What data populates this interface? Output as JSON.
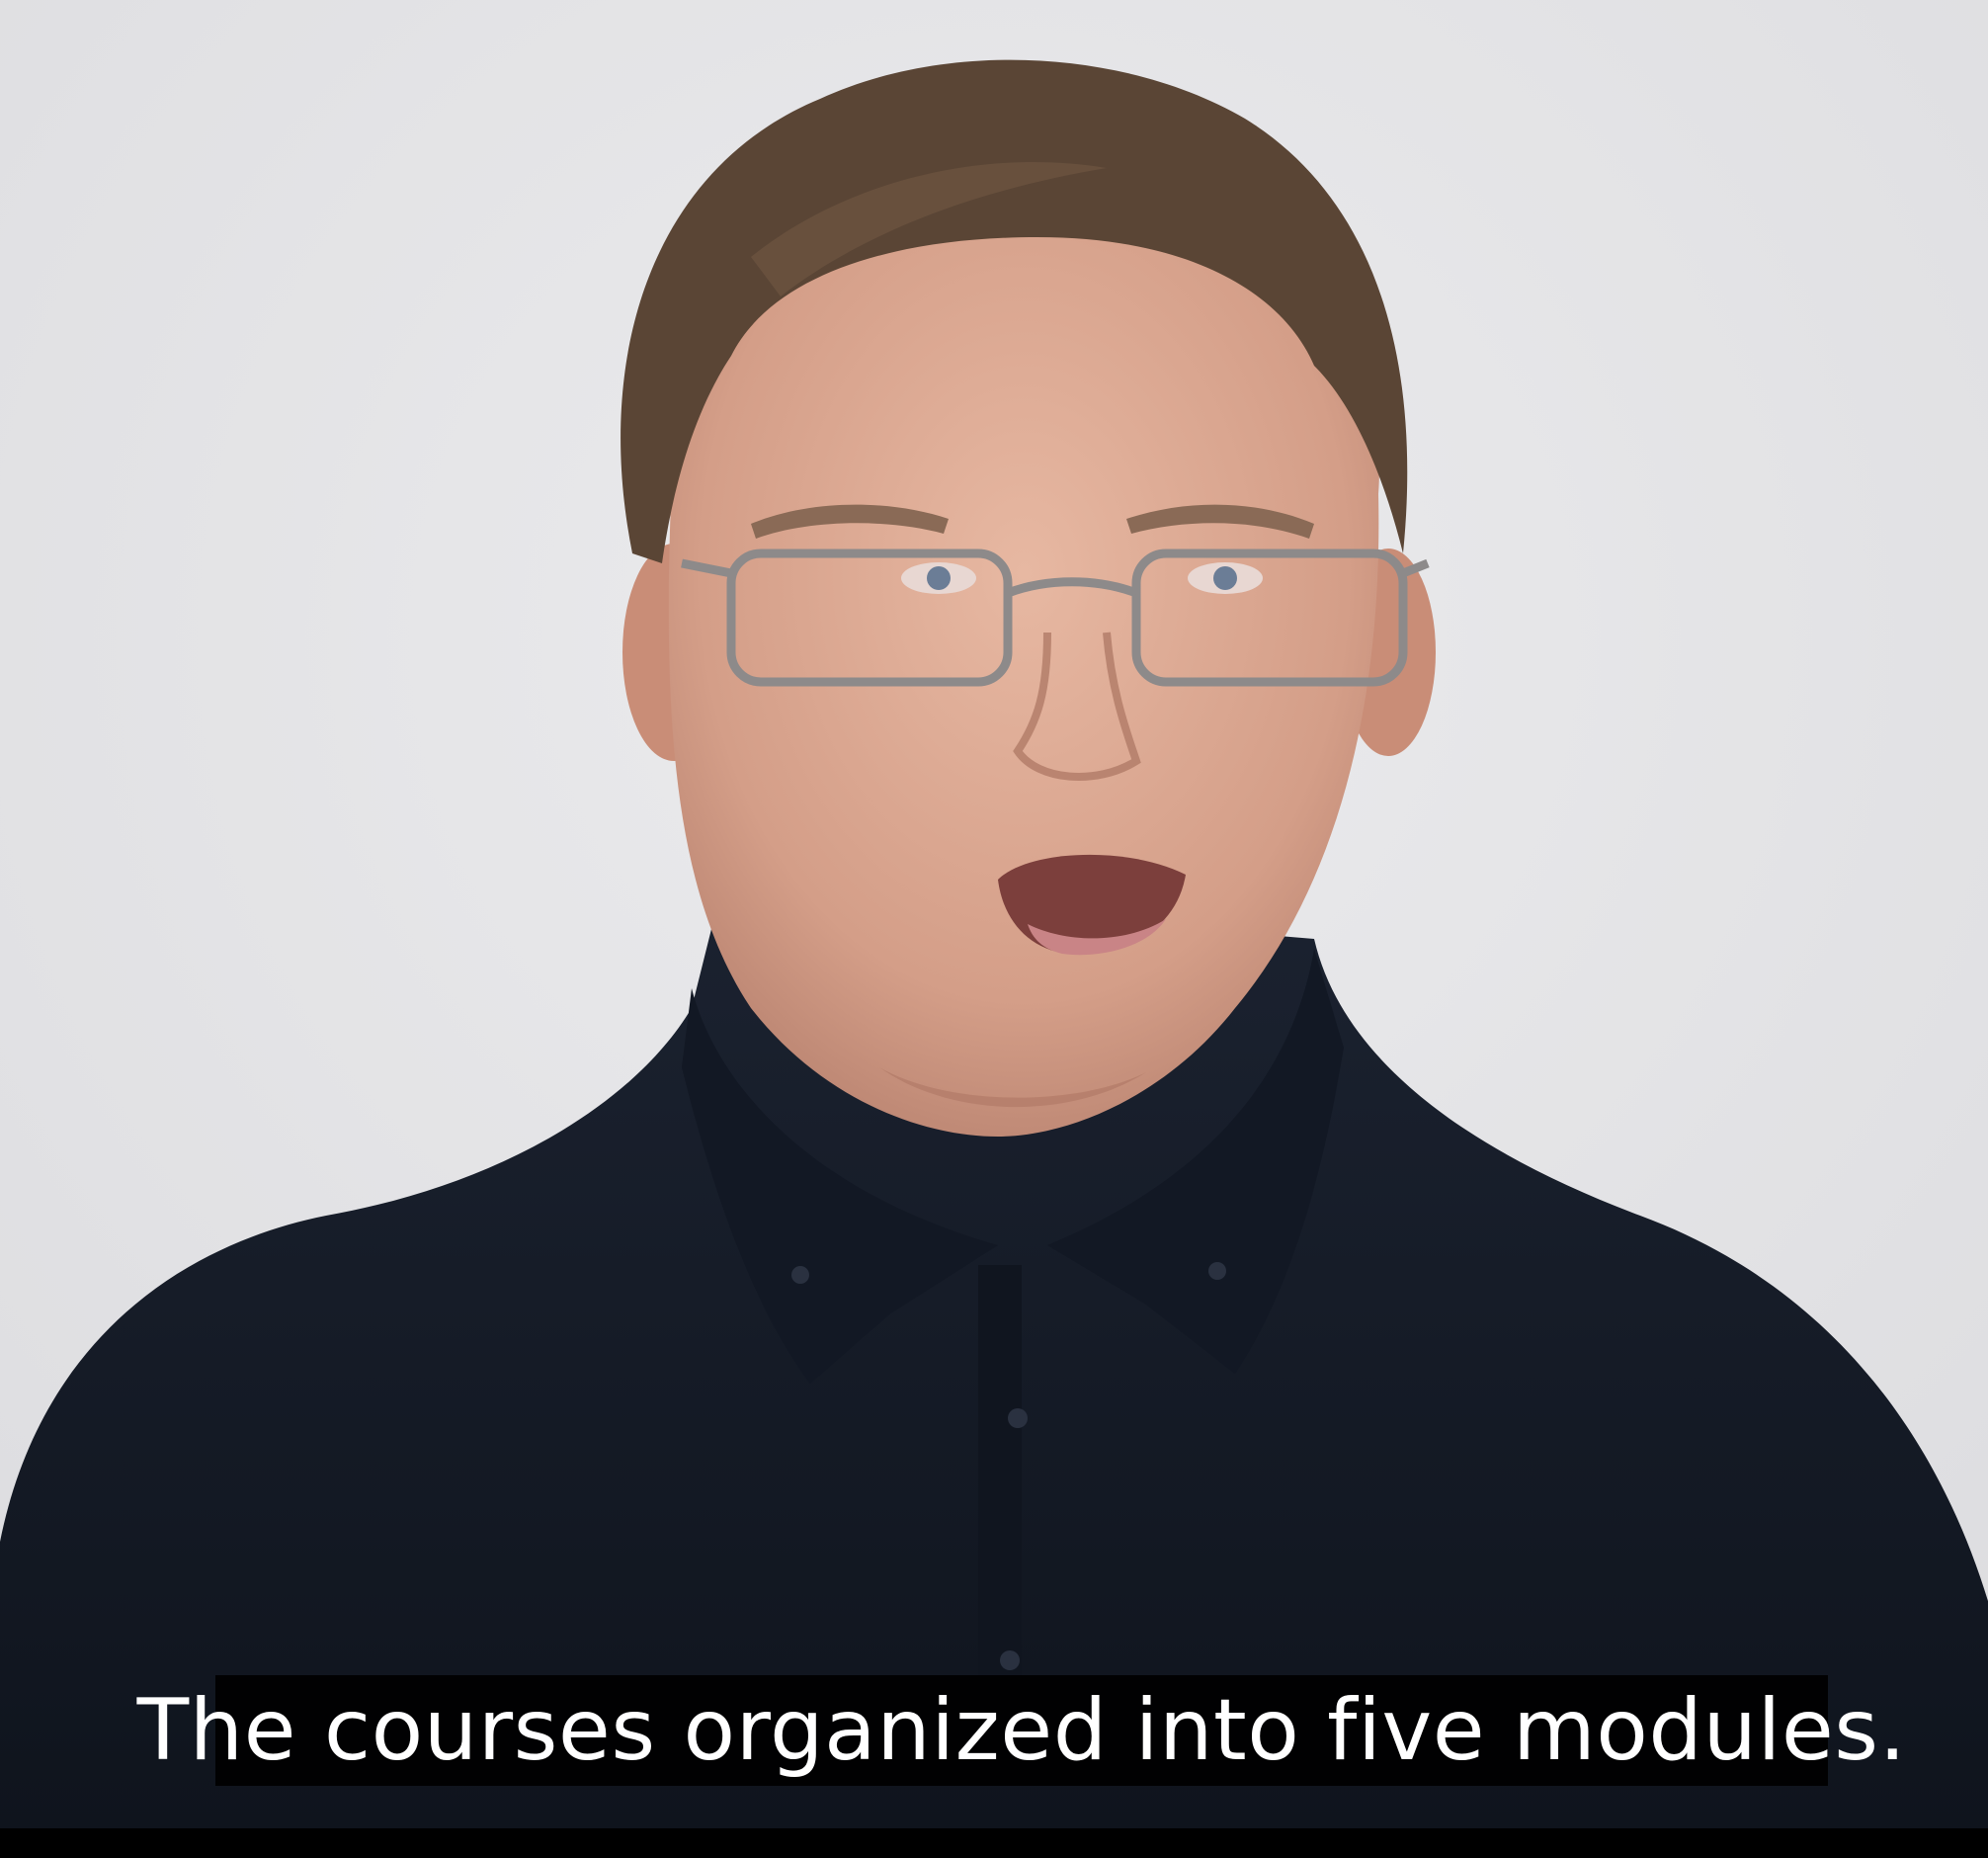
{
  "video": {
    "subject": "presenter-talking-head",
    "background_color": "#e4e4e6",
    "shirt_color": "#141a26",
    "skin_color": "#d9a894",
    "hair_color": "#5a4535"
  },
  "captions": {
    "current_line": "The courses organized into five modules."
  }
}
